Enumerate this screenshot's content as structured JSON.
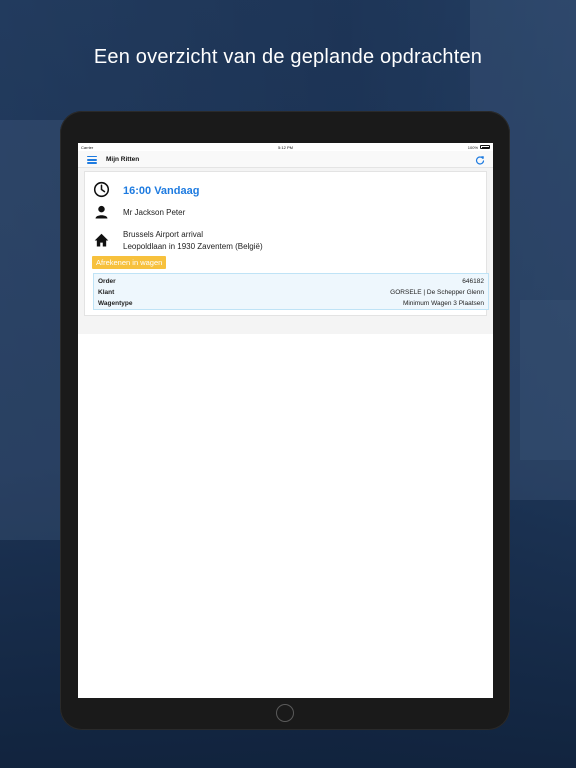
{
  "headline": "Een overzicht van de geplande opdrachten",
  "status_bar": {
    "carrier": "Carrier",
    "time": "5:12 PM",
    "battery": "100%"
  },
  "nav": {
    "title": "Mijn Ritten",
    "menu_icon": "hamburger-menu-icon",
    "refresh_icon": "refresh-icon"
  },
  "ride": {
    "time_label": "16:00 Vandaag",
    "passenger": "Mr Jackson Peter",
    "address_line1": "Brussels Airport arrival",
    "address_line2": "Leopoldlaan in 1930 Zaventem (België)",
    "pay_button": "Afrekenen in wagen",
    "details": [
      {
        "key": "Order",
        "value": "646182"
      },
      {
        "key": "Klant",
        "value": "GORSELE | De Schepper Glenn"
      },
      {
        "key": "Wagentype",
        "value": "Minimum Wagen 3 Plaatsen"
      }
    ]
  },
  "colors": {
    "accent": "#1e7be0",
    "pay_button": "#f7c13d",
    "info_bg": "#eef7fd"
  }
}
